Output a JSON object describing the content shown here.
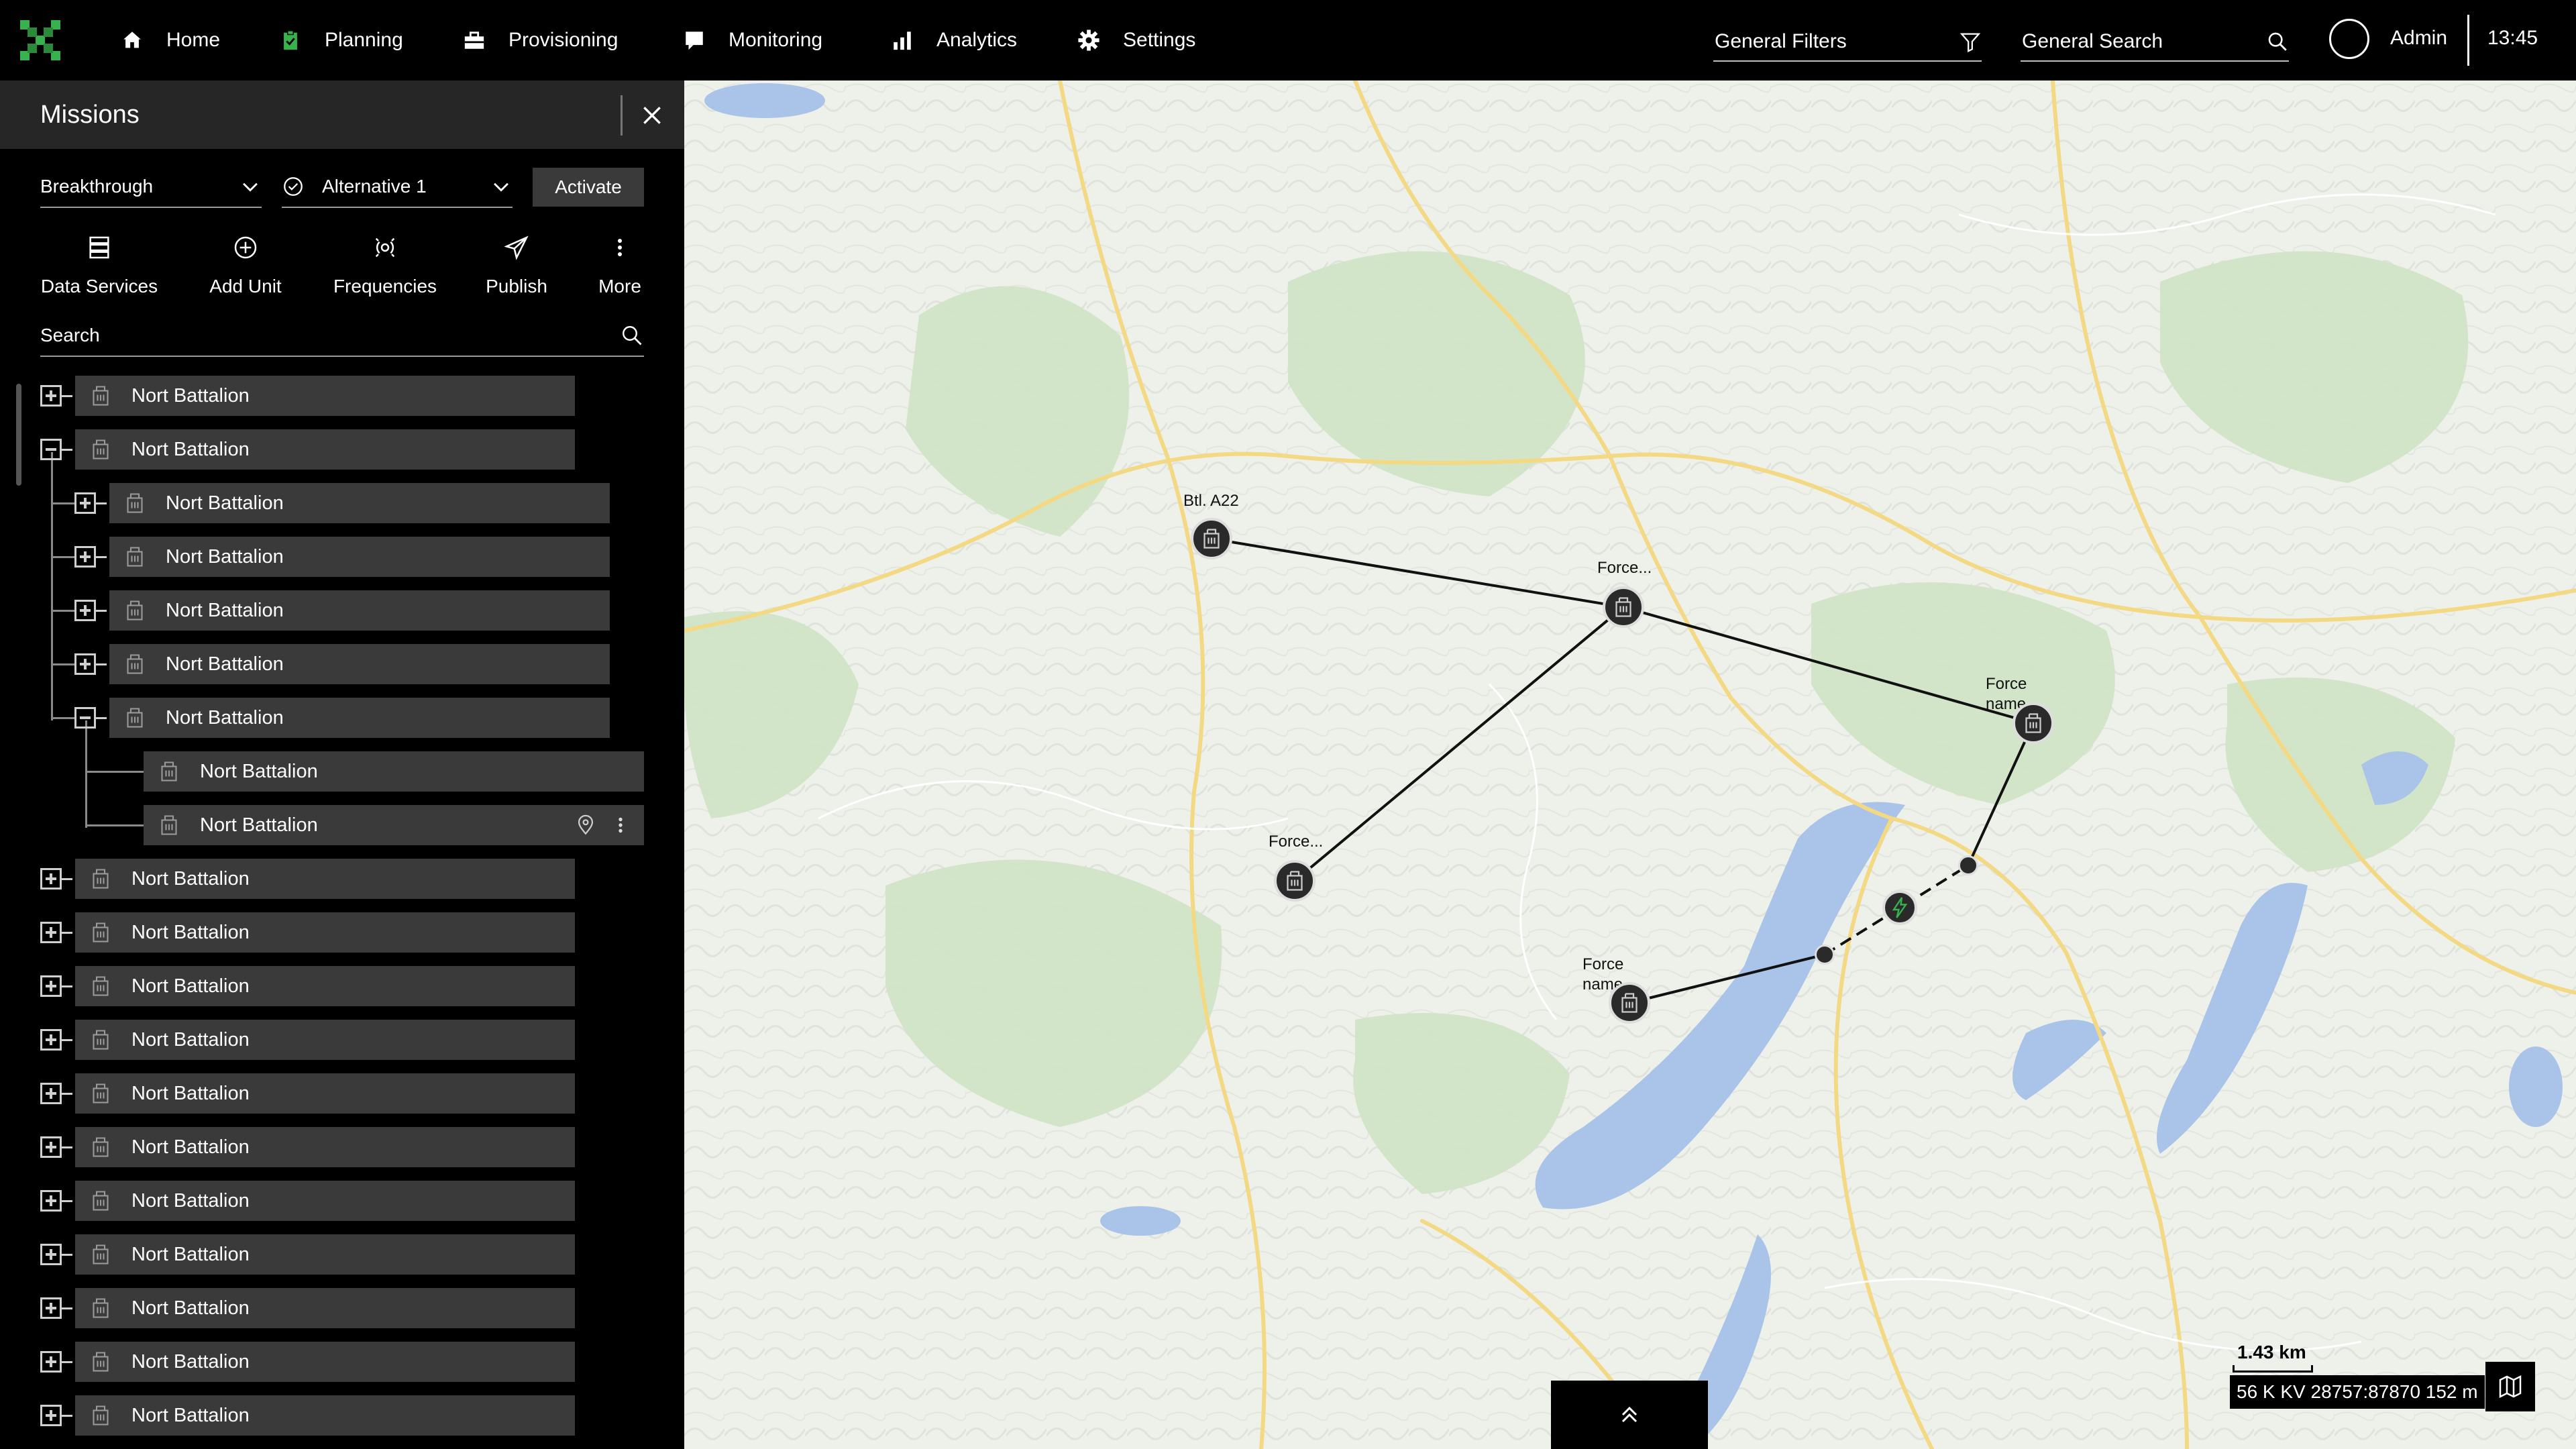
{
  "nav": {
    "items": [
      {
        "label": "Home",
        "icon": "home-icon"
      },
      {
        "label": "Planning",
        "icon": "clipboard-icon"
      },
      {
        "label": "Provisioning",
        "icon": "toolbox-icon"
      },
      {
        "label": "Monitoring",
        "icon": "monitor-icon"
      },
      {
        "label": "Analytics",
        "icon": "bar-chart-icon"
      },
      {
        "label": "Settings",
        "icon": "gear-icon"
      }
    ],
    "filters_label": "General Filters",
    "search_label": "General Search",
    "user": "Admin",
    "time": "13:45",
    "accent": "#37b24d"
  },
  "panel": {
    "title": "Missions",
    "mission_select": "Breakthrough",
    "alternative_select": "Alternative 1",
    "activate_label": "Activate",
    "tools": [
      {
        "label": "Data Services",
        "icon": "database-icon"
      },
      {
        "label": "Add Unit",
        "icon": "add-circle-icon"
      },
      {
        "label": "Frequencies",
        "icon": "radio-frequency-icon"
      },
      {
        "label": "Publish",
        "icon": "send-icon"
      },
      {
        "label": "More",
        "icon": "more-vertical-icon"
      }
    ],
    "search_placeholder": "Search",
    "tree": [
      {
        "label": "Nort Battalion",
        "level": 0,
        "expanded": false
      },
      {
        "label": "Nort Battalion",
        "level": 0,
        "expanded": true
      },
      {
        "label": "Nort Battalion",
        "level": 1,
        "expanded": false
      },
      {
        "label": "Nort Battalion",
        "level": 1,
        "expanded": false
      },
      {
        "label": "Nort Battalion",
        "level": 1,
        "expanded": false
      },
      {
        "label": "Nort Battalion",
        "level": 1,
        "expanded": false
      },
      {
        "label": "Nort Battalion",
        "level": 1,
        "expanded": true
      },
      {
        "label": "Nort Battalion",
        "level": 2
      },
      {
        "label": "Nort Battalion",
        "level": 2,
        "actions": true
      },
      {
        "label": "Nort Battalion",
        "level": 0,
        "expanded": false
      },
      {
        "label": "Nort Battalion",
        "level": 0,
        "expanded": false
      },
      {
        "label": "Nort Battalion",
        "level": 0,
        "expanded": false
      },
      {
        "label": "Nort Battalion",
        "level": 0,
        "expanded": false
      },
      {
        "label": "Nort Battalion",
        "level": 0,
        "expanded": false
      },
      {
        "label": "Nort Battalion",
        "level": 0,
        "expanded": false
      },
      {
        "label": "Nort Battalion",
        "level": 0,
        "expanded": false
      },
      {
        "label": "Nort Battalion",
        "level": 0,
        "expanded": false
      },
      {
        "label": "Nort Battalion",
        "level": 0,
        "expanded": false
      },
      {
        "label": "Nort Battalion",
        "level": 0,
        "expanded": false
      },
      {
        "label": "Nort Battalion",
        "level": 0,
        "expanded": false
      }
    ]
  },
  "map": {
    "units": [
      {
        "label": "Btl. A22"
      },
      {
        "label": "Force..."
      },
      {
        "label": "Force\nname"
      },
      {
        "label": "Force..."
      },
      {
        "label": "Force\nname"
      }
    ],
    "scale": "1.43 km",
    "coordinates": "56 K KV 28757:87870 152 m"
  }
}
